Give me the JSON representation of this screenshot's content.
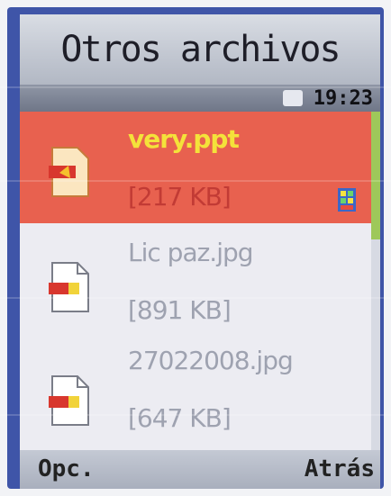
{
  "header": {
    "title": "Otros archivos"
  },
  "status": {
    "time": "19:23",
    "icon": "signal-icon"
  },
  "files": [
    {
      "name": "very.ppt",
      "size": "[217 KB]",
      "icon": "ppt-file-icon",
      "selected": true
    },
    {
      "name": "Lic paz.jpg",
      "size": "[891 KB]",
      "icon": "image-file-icon",
      "selected": false
    },
    {
      "name": "27022008.jpg",
      "size": "[647 KB]",
      "icon": "image-file-icon",
      "selected": false
    }
  ],
  "softkeys": {
    "left": "Opc.",
    "right": "Atrás"
  },
  "colors": {
    "selection": "#e8614f",
    "selected_name": "#f4e23a",
    "selected_size": "#c23b35"
  }
}
